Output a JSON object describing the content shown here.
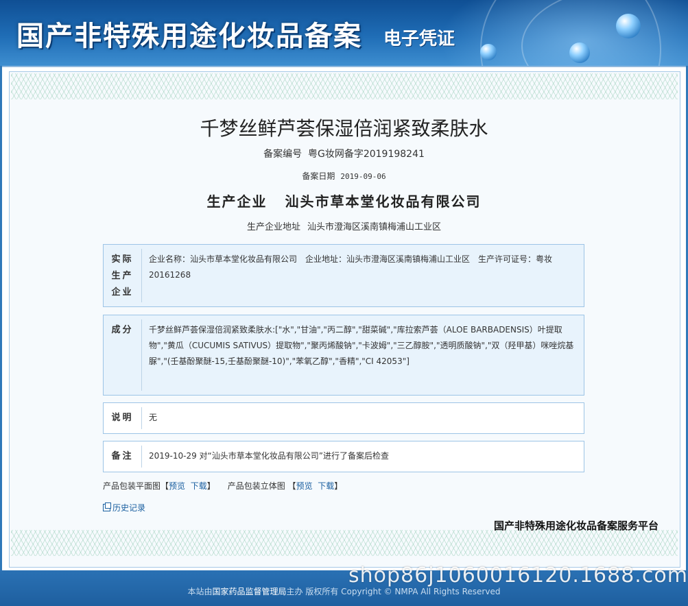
{
  "header": {
    "title": "国产非特殊用途化妆品备案",
    "subtitle": "电子凭证"
  },
  "document": {
    "product_name": "千梦丝鲜芦荟保湿倍润紧致柔肤水",
    "reg_no_label": "备案编号",
    "reg_no": "粤G妆网备字2019198241",
    "reg_date_label": "备案日期",
    "reg_date": "2019-09-06",
    "maker_label": "生产企业",
    "maker_name": "汕头市草本堂化妆品有限公司",
    "maker_addr_label": "生产企业地址",
    "maker_addr": "汕头市澄海区溪南镇梅浦山工业区"
  },
  "sections": {
    "actual_maker": {
      "label": "实际生产企业",
      "text": "企业名称：汕头市草本堂化妆品有限公司　企业地址：汕头市澄海区溪南镇梅浦山工业区　生产许可证号：粤妆20161268"
    },
    "ingredients": {
      "label": "成分",
      "text": "千梦丝鲜芦荟保湿倍润紧致柔肤水:[\"水\",\"甘油\",\"丙二醇\",\"甜菜碱\",\"库拉索芦荟（ALOE BARBADENSIS）叶提取物\",\"黄瓜（CUCUMIS SATIVUS）提取物\",\"聚丙烯酸钠\",\"卡波姆\",\"三乙醇胺\",\"透明质酸钠\",\"双（羟甲基）咪唑烷基脲\",\"(壬基酚聚醚-15,壬基酚聚醚-10)\",\"苯氧乙醇\",\"香精\",\"CI 42053\"]"
    },
    "description": {
      "label": "说明",
      "text": "无"
    },
    "remark": {
      "label": "备注",
      "text": "2019-10-29 对“汕头市草本堂化妆品有限公司”进行了备案后检查"
    }
  },
  "links": {
    "flat_label": "产品包装平面图",
    "solid_label": "产品包装立体图",
    "preview": "预览",
    "download": "下载",
    "history": "历史记录"
  },
  "platform": "国产非特殊用途化妆品备案服务平台",
  "footer": {
    "prefix": "本站由",
    "org": "国家药品监督管理局",
    "suffix": "主办 版权所有 Copyright © NMPA All Rights Reserved"
  },
  "watermark": "shop86j1060016120.1688.com"
}
